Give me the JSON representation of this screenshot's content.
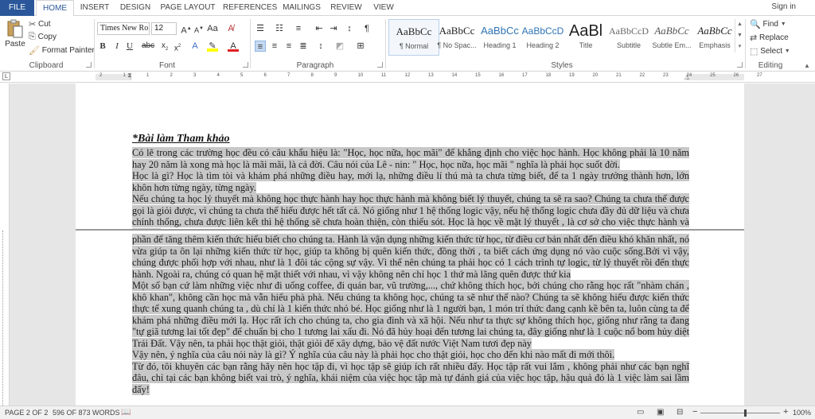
{
  "tabs": {
    "file": "FILE",
    "home": "HOME",
    "insert": "INSERT",
    "design": "DESIGN",
    "page_layout": "PAGE LAYOUT",
    "references": "REFERENCES",
    "mailings": "MAILINGS",
    "review": "REVIEW",
    "view": "VIEW"
  },
  "signin": "Sign in",
  "clipboard": {
    "paste": "Paste",
    "cut": "Cut",
    "copy": "Copy",
    "format_painter": "Format Painter",
    "label": "Clipboard"
  },
  "font": {
    "family": "Times New Ro",
    "size": "12",
    "label": "Font"
  },
  "paragraph": {
    "label": "Paragraph"
  },
  "styles": {
    "label": "Styles",
    "items": [
      {
        "preview": "AaBbCc",
        "name": "¶ Normal"
      },
      {
        "preview": "AaBbCc",
        "name": "¶ No Spac..."
      },
      {
        "preview": "AaBbCc",
        "name": "Heading 1"
      },
      {
        "preview": "AaBbCcD",
        "name": "Heading 2"
      },
      {
        "preview": "AaBl",
        "name": "Title"
      },
      {
        "preview": "AaBbCcD",
        "name": "Subtitle"
      },
      {
        "preview": "AaBbCc",
        "name": "Subtle Em..."
      },
      {
        "preview": "AaBbCc",
        "name": "Emphasis"
      }
    ]
  },
  "editing": {
    "find": "Find",
    "replace": "Replace",
    "select": "Select",
    "label": "Editing"
  },
  "ruler_ticks": [
    "2",
    "1",
    "1",
    "2",
    "3",
    "4",
    "5",
    "6",
    "7",
    "8",
    "9",
    "10",
    "11",
    "12",
    "13",
    "14",
    "15",
    "16",
    "17",
    "18",
    "19",
    "20",
    "21",
    "22",
    "23",
    "24",
    "25",
    "26",
    "27"
  ],
  "document": {
    "title": "*Bài làm Tham khảo",
    "page1": [
      "Có lẽ trong các trường học đều có câu khẩu hiệu là: \"Học, học nữa, học mãi\" để khẳng định cho việc học hành. Học không phải là 10 năm hay 20 năm là xong mà học là mãi mãi, là cả đời. Câu nói của Lê - nin: \" Học, học nữa, học mãi \" nghĩa là phải học suốt đời.",
      "Học là gì? Học là tìm tòi và khám phá những điều hay, mới lạ, những điều lí thú mà ta chưa từng biết, để ta 1 ngày trưởng thành hơn, lớn khôn hơn từng ngày, từng ngày.",
      "Nếu chúng ta học lý thuyết mà không học thực hành hay học thực hành mà không biết lý thuyết, chúng ta sẽ ra sao? Chúng ta chưa thể được gọi là giỏi được, vì chúng ta chưa thể hiểu được hết tất cả. Nó giống như 1 hệ thống logic vậy, nếu hệ thống logic chưa đầy đủ dữ liệu và chưa chính thống, chưa được liên kết thì hệ thống sẽ chưa hoàn thiện, còn thiếu sót. Học là học về mặt lý thuyết , là cơ sở cho việc thực hành và cũng là"
    ],
    "page2": [
      "phần để tăng thêm kiến thức hiểu biết cho chúng ta. Hành là vận dụng những kiến thức từ học, từ điều cơ bản nhất đến điều khó khăn nhất, nó vừa giúp ta ôn lại những kiến thức từ học, giúp ta không bị quên kiến thức, đồng thời , ta biết cách ứng dụng nó vào cuộc sống.Bởi vì vậy, chúng được phối hợp với nhau, như là 1 đôi tác cộng sự vậy. Vì thế nên chúng ta phải học có 1 cách trình tự logic, từ lý thuyết rồi đến thực hành. Ngoài ra, chúng có quan hệ mật thiết với nhau, vì vậy không nên chỉ học 1 thứ mà lãng quên được thứ kia",
      "Một số bạn cứ làm những việc như đi uống coffee, đi quán bar, vũ trường,..., chứ không thích học, bởi chúng cho rằng học rất \"nhàm chán , khô khan\", không cần học mà vẫn hiểu phà phà. Nếu chúng ta không học, chúng ta sẽ như thế nào? Chúng ta sẽ không hiểu được kiến thức thực tế xung quanh chúng ta , dù chỉ là 1 kiến thức nhỏ bé. Học giống như là 1 người bạn, 1 món trí thức đang cạnh kề bên ta, luôn cùng ta để khám phá những điều mới lạ. Học rất ích cho chúng ta, cho gia đình và xã hội. Nếu như ta thực sự không thích học, giống như rằng ta đang \"tự giã tương lai tốt đẹp\" để chuẩn bị cho 1 tương lai xấu đi. Nó đã hủy hoại đến tương lai chúng ta, đây giống như là 1 cuộc nổ bom hủy diệt Trái Đất. Vậy nên, ta phải học thật giỏi, thật giỏi để xây dựng, bảo vệ đất nước Việt Nam tươi đẹp này",
      "Vậy nên, ý nghĩa của câu nói này là gì? Ý nghĩa của câu này là phải học cho thật giỏi, học cho đến khi nào mất đi mới thôi.",
      "Từ đó, tôi khuyên các bạn rằng  hãy nên học tập đi, vì học tập sẽ giúp ích rất nhiều đấy. Học tập rất vui lắm , không phải như các bạn nghĩ đâu, chỉ tại các bạn không biết vai trò, ý nghĩa, khái niệm của việc học tập mà tự đánh giá của việc học tập, hậu quả đó là 1 việc làm sai lầm đấy!"
    ]
  },
  "status": {
    "page": "PAGE 2 OF 2",
    "words": "596 OF 873 WORDS",
    "zoom": "100%"
  }
}
